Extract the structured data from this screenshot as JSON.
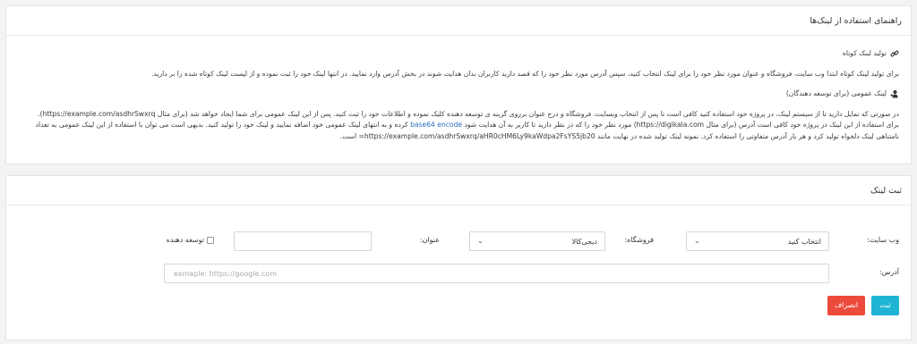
{
  "guide": {
    "title": "راهنمای استفاده از لینک‌ها",
    "short_link": {
      "icon": "link-icon",
      "title": "تولید لینک کوتاه",
      "text": "برای تولید لینک کوتاه ابتدا وب سایت، فروشگاه و عنوان مورد نظر خود را برای لینک انتخاب کنید، سپس آدرس مورد نظر خود را که قصد دارید کاربران بدان هدایت شوند در بخش آدرس وارد نمایید. در انتها لینک خود را ثبت نموده و از لیست لینک کوتاه شده را بر دارید."
    },
    "public_link": {
      "icon": "user-plus-icon",
      "title": "لینک عمومی (برای توسعه دهندگان)",
      "line1": "در صورتی که تمایل دارید تا از سیستم لینک، در پروژه خود استفاده کنید کافی است تا پس از انتخاب وبسایت، فروشگاه و درج عنوان برروی گزینه ی توسعه دهنده کلیک نموده و اطلاعات خود را ثبت کنید. پس از این لینک عمومی برای شما ایجاد خواهد شد (برای مثال https://example.com/asdhrSwxrq).",
      "line2a": "برای استفاده از این لینک در پروژه خود کافی است آدرس (برای مثال https://digikala.com) مورد نظر خود را که در نظر دارید تا کاربر به آن هدایت شود",
      "line2_link": "base64 encode",
      "line2b": "کرده و به انتهای لینک عمومی خود اضافه نمایید و لینک خود را تولید کنید. بدیهی است می توان با استفاده از این لینک عمومی به تعداد",
      "line3": "نامتناهی لینک دلخواه تولید کرد و هر بار آدرس متفاوتی را استفاده کرد. نمونه لینک تولید شده در نهایت مانند https://example.com/asdhrSwxrq/aHR0cHM6Ly9kaWdpa2FsYS5jb20= است."
    }
  },
  "form": {
    "title": "ثبت لینک",
    "website_label": "وب سایت:",
    "website_value": "انتخاب کنید",
    "store_label": "فروشگاه:",
    "store_value": "دیجی‌کالا",
    "title_label": "عنوان:",
    "title_value": "",
    "developer_label": "توسعه دهنده",
    "developer_checked": false,
    "address_label": "آدرس:",
    "address_placeholder": "exmaple: https://google.com",
    "save_label": "ثبت",
    "cancel_label": "انصراف"
  },
  "colors": {
    "save": "#1fb4d4",
    "cancel": "#ec4a3a",
    "link": "#2a6ebb"
  }
}
